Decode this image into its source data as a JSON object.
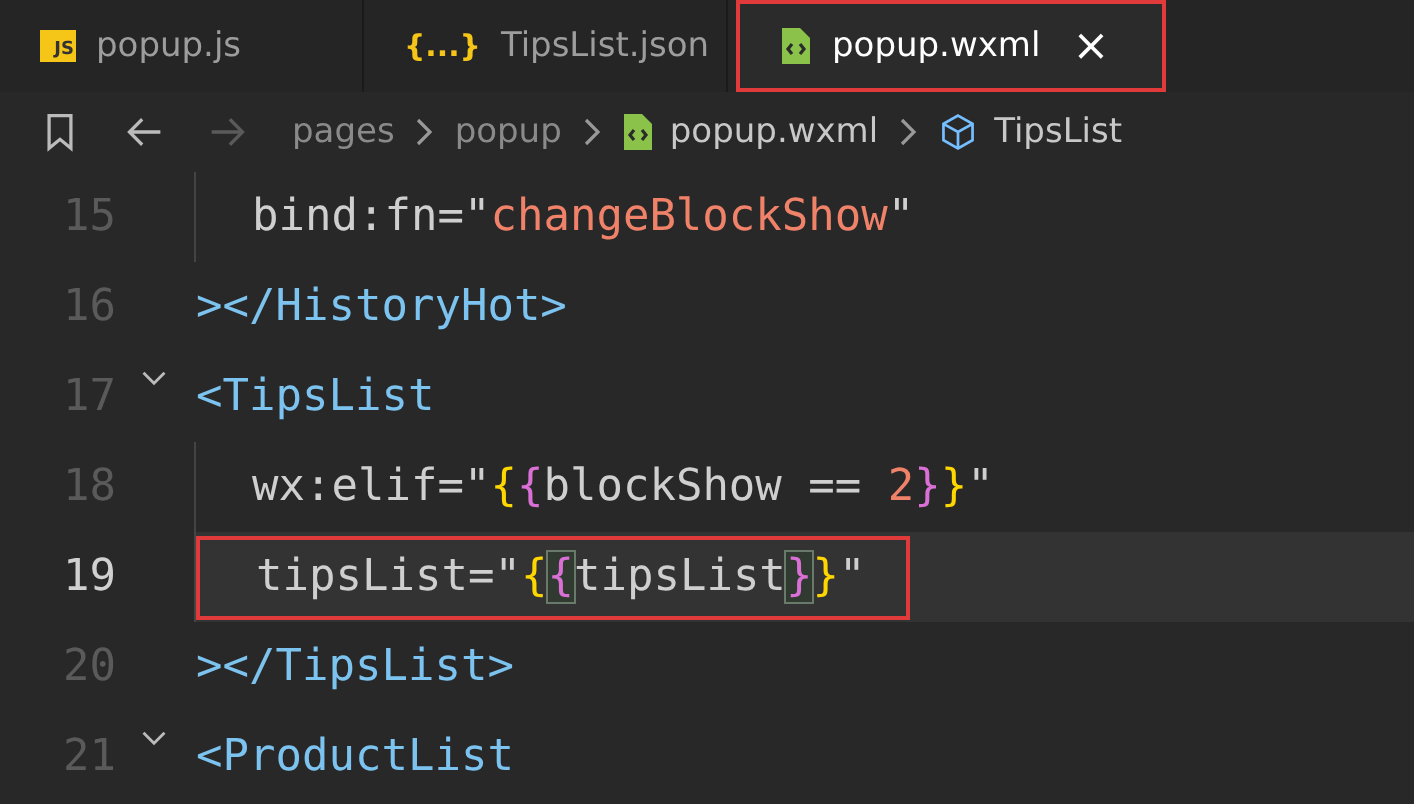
{
  "tabs": [
    {
      "kind": "js",
      "icon_text": "JS",
      "label": "popup.js",
      "selected": false,
      "outlined": false
    },
    {
      "kind": "json",
      "icon_text": "{...}",
      "label": "TipsList.json",
      "selected": false,
      "outlined": false
    },
    {
      "kind": "wxml",
      "label": "popup.wxml",
      "close": "×",
      "selected": true,
      "outlined": true
    }
  ],
  "breadcrumb": {
    "items": [
      {
        "kind": "folder",
        "label": "pages"
      },
      {
        "kind": "folder",
        "label": "popup"
      },
      {
        "kind": "file",
        "label": "popup.wxml"
      },
      {
        "kind": "symbol",
        "label": "TipsList"
      }
    ]
  },
  "lines": [
    {
      "number": "15",
      "foldable": false,
      "indented": true,
      "current": false,
      "outlined": false,
      "tokens": [
        {
          "kind": "attr",
          "text": "bind:fn="
        },
        {
          "kind": "quote",
          "text": "\""
        },
        {
          "kind": "string",
          "text": "changeBlockShow"
        },
        {
          "kind": "quote",
          "text": "\""
        }
      ]
    },
    {
      "number": "16",
      "foldable": false,
      "indented": false,
      "current": false,
      "outlined": false,
      "tokens": [
        {
          "kind": "tag",
          "text": "></HistoryHot>"
        }
      ]
    },
    {
      "number": "17",
      "foldable": true,
      "indented": false,
      "current": false,
      "outlined": false,
      "tokens": [
        {
          "kind": "tag",
          "text": "<TipsList"
        }
      ]
    },
    {
      "number": "18",
      "foldable": false,
      "indented": true,
      "current": false,
      "outlined": false,
      "tokens": [
        {
          "kind": "attr",
          "text": "wx:elif="
        },
        {
          "kind": "quote",
          "text": "\""
        },
        {
          "kind": "brace1",
          "text": "{"
        },
        {
          "kind": "brace2",
          "text": "{"
        },
        {
          "kind": "attr",
          "text": "blockShow == "
        },
        {
          "kind": "string",
          "text": "2"
        },
        {
          "kind": "brace2",
          "text": "}"
        },
        {
          "kind": "brace1",
          "text": "}"
        },
        {
          "kind": "quote",
          "text": "\""
        }
      ]
    },
    {
      "number": "19",
      "foldable": false,
      "indented": true,
      "current": true,
      "outlined": true,
      "tokens": [
        {
          "kind": "attr",
          "text": "tipsList="
        },
        {
          "kind": "quote",
          "text": "\""
        },
        {
          "kind": "brace1",
          "text": "{"
        },
        {
          "kind": "brace2-match",
          "text": "{"
        },
        {
          "kind": "attr",
          "text": "tipsList"
        },
        {
          "kind": "brace2-match",
          "text": "}"
        },
        {
          "kind": "brace1",
          "text": "}"
        },
        {
          "kind": "quote",
          "text": "\""
        }
      ]
    },
    {
      "number": "20",
      "foldable": false,
      "indented": false,
      "current": false,
      "outlined": false,
      "tokens": [
        {
          "kind": "tag",
          "text": "></TipsList>"
        }
      ]
    },
    {
      "number": "21",
      "foldable": true,
      "indented": false,
      "current": false,
      "outlined": false,
      "tokens": [
        {
          "kind": "tag",
          "text": "<ProductList"
        }
      ]
    }
  ]
}
